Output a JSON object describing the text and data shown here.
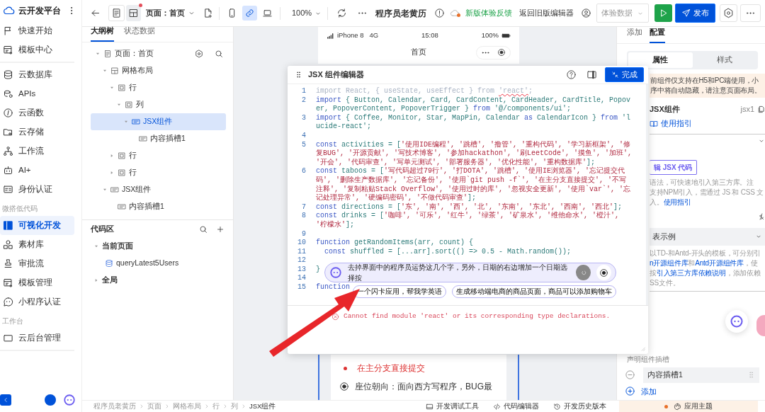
{
  "sidebar": {
    "brand": "云开发平台",
    "groups": [
      {
        "items": [
          {
            "label": "快速开始",
            "selected": false
          },
          {
            "label": "模板中心",
            "selected": false
          }
        ]
      },
      {
        "items": [
          {
            "label": "云数据库",
            "selected": false
          },
          {
            "label": "APIs",
            "selected": false
          },
          {
            "label": "云函数",
            "selected": false
          },
          {
            "label": "云存储",
            "selected": false
          },
          {
            "label": "工作流",
            "selected": false
          },
          {
            "label": "AI+",
            "selected": false
          },
          {
            "label": "身份认证",
            "selected": false
          }
        ]
      },
      {
        "title": "微搭低代码",
        "items": [
          {
            "label": "可视化开发",
            "selected": true
          },
          {
            "label": "素材库",
            "selected": false
          },
          {
            "label": "审批流",
            "selected": false
          },
          {
            "label": "模板管理",
            "selected": false
          },
          {
            "label": "小程序认证",
            "selected": false
          }
        ]
      },
      {
        "title": "工作台",
        "items": [
          {
            "label": "云后台管理",
            "selected": false
          }
        ]
      }
    ]
  },
  "toolbar": {
    "view_toggles": [
      {
        "selected": false
      },
      {
        "selected": true
      }
    ],
    "page_select": "页面：首页",
    "devices": [
      {
        "selected": false
      },
      {
        "selected": true
      },
      {
        "selected": false
      }
    ],
    "zoom": "100%",
    "app_title": "程序员老黄历",
    "feedback_link": "新版体验反馈",
    "legacy_link": "返回旧版编辑器",
    "data_select": "体验数据",
    "publish_button": "发布"
  },
  "outline": {
    "tabs": [
      {
        "label": "大纲树",
        "selected": true
      },
      {
        "label": "状态数据",
        "selected": false
      }
    ],
    "tree": [
      {
        "kind": "page",
        "label": "页面：首页",
        "expanded": true,
        "selected": false,
        "children": [
          {
            "kind": "grid",
            "label": "网格布局",
            "expanded": true,
            "selected": false,
            "children": [
              {
                "kind": "row",
                "label": "行",
                "expanded": true,
                "selected": false,
                "children": [
                  {
                    "kind": "column",
                    "label": "列",
                    "expanded": true,
                    "selected": false,
                    "children": [
                      {
                        "kind": "jsx",
                        "label": "JSX组件",
                        "expanded": true,
                        "selected": true,
                        "children": [
                          {
                            "kind": "slot",
                            "label": "内容插槽1",
                            "selected": false
                          }
                        ]
                      }
                    ]
                  }
                ]
              },
              {
                "kind": "row",
                "label": "行",
                "expanded": false,
                "selected": false
              },
              {
                "kind": "row",
                "label": "行",
                "expanded": false,
                "selected": false
              }
            ]
          },
          {
            "kind": "jsx",
            "label": "JSX组件",
            "expanded": true,
            "selected": false,
            "children": [
              {
                "kind": "slot",
                "label": "内容插槽1",
                "selected": false
              }
            ]
          }
        ]
      }
    ]
  },
  "code_area": {
    "title": "代码区",
    "groups": [
      {
        "label": "当前页面",
        "expanded": true,
        "items": [
          {
            "label": "queryLatest5Users"
          }
        ]
      },
      {
        "label": "全局",
        "expanded": false
      }
    ]
  },
  "canvas": {
    "status_bar": {
      "carrier": "iPhone 8",
      "network": "4G",
      "time": "15:08",
      "battery": "100%"
    },
    "nav_title": "首页",
    "content": [
      {
        "kind": "bullet",
        "text": "在主分支直接提交"
      },
      {
        "kind": "icon-line",
        "text": "座位朝向：面向西方写程序，BUG最"
      }
    ]
  },
  "jsx_editor": {
    "title": "JSX 组件编辑器",
    "done_button": "完成",
    "lines": [
      {
        "number": "1",
        "segments": [
          {
            "kind": "dim",
            "text": "import React, { useState, useEffect } from "
          },
          {
            "kind": "err",
            "text": "'react'"
          },
          {
            "kind": "dim",
            "text": ";"
          }
        ]
      },
      {
        "number": "2",
        "segments": [
          {
            "kind": "kw",
            "text": "import"
          },
          {
            "kind": "id",
            "text": " { Button, Calendar, Card, CardContent, CardHeader, CardTitle, Popover, PopoverContent, PopoverTrigger } "
          },
          {
            "kind": "kw",
            "text": "from"
          },
          {
            "kind": "id",
            "text": " '@/components/ui';"
          }
        ]
      },
      {
        "number": "3",
        "segments": [
          {
            "kind": "kw",
            "text": "import"
          },
          {
            "kind": "id",
            "text": " { Coffee, Monitor, Star, MapPin, Calendar "
          },
          {
            "kind": "kw",
            "text": "as"
          },
          {
            "kind": "id",
            "text": " CalendarIcon } "
          },
          {
            "kind": "kw",
            "text": "from"
          },
          {
            "kind": "id",
            "text": " 'lucide-react';"
          }
        ]
      },
      {
        "number": "4"
      },
      {
        "number": "5",
        "segments": [
          {
            "kind": "kw",
            "text": "const"
          },
          {
            "kind": "id",
            "text": " activities = ["
          },
          {
            "kind": "str",
            "text": "'使用IDE编程', '跳槽', '撸管', '重构代码', '学习新框架', '修复BUG', '开源贡献', '写技术博客', '参加hackathon', '刷LeetCode', '摸鱼', '加班', '开会', '代码审查', '写单元测试', '部署服务器', '优化性能', '重构数据库'"
          },
          {
            "kind": "id",
            "text": "];"
          }
        ]
      },
      {
        "number": "6",
        "segments": [
          {
            "kind": "kw",
            "text": "const"
          },
          {
            "kind": "id",
            "text": " taboos = ["
          },
          {
            "kind": "str",
            "text": "'写代码超过79行', '打DOTA', '跳槽', '使用IE浏览器', '忘记提交代码', '删除生产数据库', '忘记备份', '使用`git push -f`', '在主分支直接提交', '不写注释', '复制粘贴Stack Overflow', '使用过时的库', '忽视安全更新', '使用`var`', '忘记处理异常', '硬编码密码', '不做代码审查'"
          },
          {
            "kind": "id",
            "text": "];"
          }
        ]
      },
      {
        "number": "7",
        "segments": [
          {
            "kind": "kw",
            "text": "const"
          },
          {
            "kind": "id",
            "text": " directions = ["
          },
          {
            "kind": "str",
            "text": "'东', '南', '西', '北', '东南', '东北', '西南', '西北'"
          },
          {
            "kind": "id",
            "text": "];"
          }
        ]
      },
      {
        "number": "8",
        "segments": [
          {
            "kind": "kw",
            "text": "const"
          },
          {
            "kind": "id",
            "text": " drinks = ["
          },
          {
            "kind": "str",
            "text": "'咖啡', '可乐', '红牛', '绿茶', '矿泉水', '维他命水', '橙汁', '柠檬水'"
          },
          {
            "kind": "id",
            "text": "];"
          }
        ]
      },
      {
        "number": "9"
      },
      {
        "number": "10",
        "segments": [
          {
            "kind": "kw",
            "text": "function"
          },
          {
            "kind": "id",
            "text": " getRandomItems(arr, count) {"
          }
        ]
      },
      {
        "number": "11",
        "segments": [
          {
            "kind": "kw",
            "text": "  const"
          },
          {
            "kind": "id",
            "text": " shuffled = [...arr].sort(() => 0.5 - Math.random());"
          }
        ]
      },
      {
        "number": "12"
      },
      {
        "number": "13",
        "segments": [
          {
            "kind": "id",
            "text": "}"
          }
        ]
      },
      {
        "number": "14"
      },
      {
        "number": "15",
        "segments": [
          {
            "kind": "kw",
            "text": "function"
          }
        ]
      }
    ],
    "ai_prompt": {
      "text": "去掉界面中的程序员运势这几个字，另外，日期的右边增加一个日期选择按",
      "suggestions": [
        "一个闪卡应用，帮我学英语",
        "生成移动端电商的商品页面，商品可以添加购物车"
      ]
    },
    "error": "Cannot find module 'react' or its corresponding type declarations."
  },
  "properties": {
    "tabs": [
      {
        "label": "添加",
        "selected": false
      },
      {
        "label": "配置",
        "selected": true
      }
    ],
    "segments": [
      {
        "label": "属性",
        "selected": true
      },
      {
        "label": "样式",
        "selected": false
      }
    ],
    "notice": [
      "前组件仅支持在H5和PC端使用，小",
      "序中将自动隐藏，请注意页面布局。"
    ],
    "component": {
      "name": "JSX组件",
      "id": "jsx1",
      "guide_link": "使用指引"
    },
    "edit_button": "辑 JSX 代码",
    "code_help": [
      [
        {
          "text": "语法，可快速地引入第三方库。注"
        }
      ],
      [
        {
          "text": "支持NPM引入，需通过 JS 和 CSS 文"
        }
      ],
      [
        {
          "text": "入。"
        },
        {
          "text": "使用指引",
          "link": true
        }
      ]
    ],
    "template_select": "表示例",
    "template_help": [
      [
        {
          "text": "以TD-和Antd-开头的模板，可分别引"
        }
      ],
      [
        {
          "text": "n开源组件库",
          "link": true
        },
        {
          "text": "和"
        },
        {
          "text": "Antd开源组件库",
          "link": true
        },
        {
          "text": "，使"
        }
      ],
      [
        {
          "text": "按"
        },
        {
          "text": "引入第三方库依赖说明",
          "link": true
        },
        {
          "text": "，添加依赖"
        }
      ],
      [
        {
          "text": "SS文件。"
        }
      ]
    ],
    "slots_label": "声明组件插槽",
    "slots": [
      {
        "value": "内容插槽1"
      }
    ],
    "add_slot": "添加"
  },
  "footer": {
    "breadcrumb": [
      "程序员老黄历",
      "页面",
      "网格布局",
      "行",
      "列",
      "JSX组件"
    ],
    "tools": [
      "开发调试工具",
      "代码编辑器",
      "开发历史版本"
    ],
    "theme": "应用主题"
  }
}
